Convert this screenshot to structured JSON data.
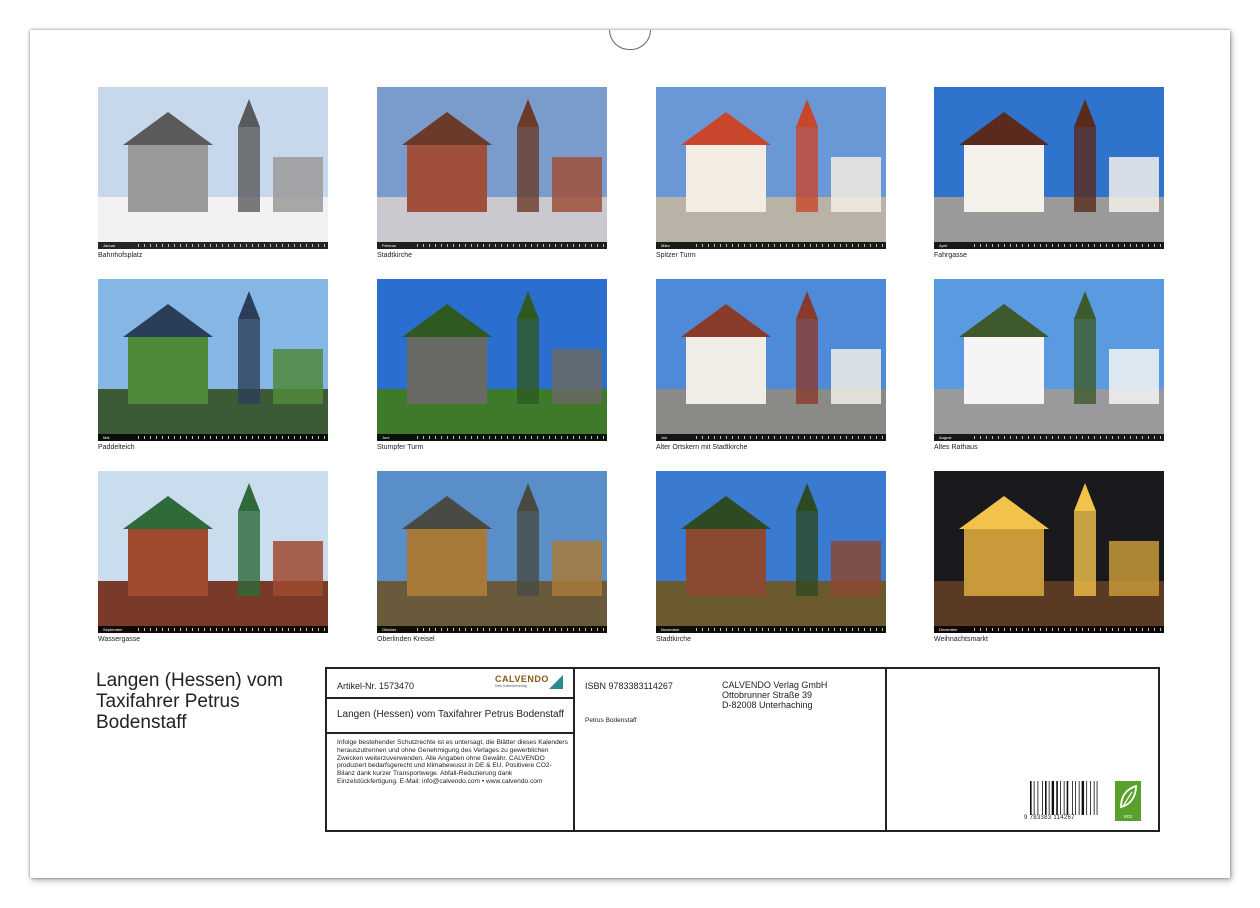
{
  "months": [
    {
      "month": "Januar",
      "caption": "Bahnhofsplatz"
    },
    {
      "month": "Februar",
      "caption": "Stadtkirche"
    },
    {
      "month": "März",
      "caption": "Spitzer Turm"
    },
    {
      "month": "April",
      "caption": "Fahrgasse"
    },
    {
      "month": "Mai",
      "caption": "Paddelteich"
    },
    {
      "month": "Juni",
      "caption": "Stumpfer Turm"
    },
    {
      "month": "Juli",
      "caption": "Alter Ortskern mit Stadtkirche"
    },
    {
      "month": "August",
      "caption": "Altes Rathaus"
    },
    {
      "month": "September",
      "caption": "Wassergasse"
    },
    {
      "month": "Oktober",
      "caption": "Oberlinden Kreisel"
    },
    {
      "month": "November",
      "caption": "Stadtkirche"
    },
    {
      "month": "Dezember",
      "caption": "Weihnachtsmarkt"
    }
  ],
  "book_title": "Langen (Hessen) vom Taxifahrer Petrus Bodenstaff",
  "info": {
    "article_no": "Artikel-Nr. 1573470",
    "logo": "CALVENDO",
    "logo_sub": "Dein Kalenderverlag",
    "calendar_title": "Langen (Hessen) vom Taxifahrer Petrus Bodenstaff",
    "legal": "Infolge bestehender Schutzrechte ist es untersagt, die Blätter dieses Kalenders herauszutrennen und ohne Genehmigung des Verlages zu gewerblichen Zwecken weiterzuverwenden. Alle Angaben ohne Gewähr. CALVENDO produziert bedarfsgerecht und klimabewusst in DE & EU. Positivere CO2-Bilanz dank kurzer Transportwege. Abfall-Reduzierung dank Einzelstückfertigung. E-Mail: info@calvendo.com • www.calvendo.com",
    "isbn": "ISBN 9783383114267",
    "publisher_name": "CALVENDO Verlag GmbH",
    "publisher_street": "Ottobrunner Straße 39",
    "publisher_city": "D-82008 Unterhaching",
    "author": "Petrus Bodenstaff",
    "barcode_number": "9 783383 114267",
    "eco_label": "eco"
  }
}
